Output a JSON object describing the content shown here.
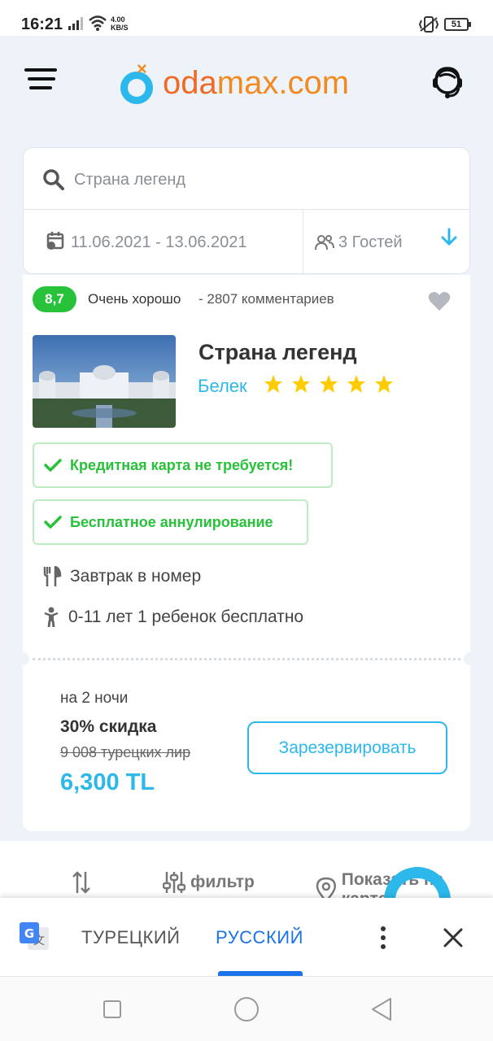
{
  "status_bar": {
    "time": "16:21",
    "speed_value": "4.00",
    "speed_unit": "KB/S",
    "battery": "51"
  },
  "header": {
    "logo_part1": "oda",
    "logo_part2": "max",
    "logo_part3": ".com"
  },
  "search": {
    "query": "Страна легенд",
    "dates": "11.06.2021 - 13.06.2021",
    "guests": "3 Гостей"
  },
  "hotel": {
    "rating": "8,7",
    "rating_word": "Очень хорошо",
    "reviews": "- 2807 комментариев",
    "name": "Страна легенд",
    "city": "Белек",
    "stars": 5,
    "features": [
      {
        "label": "Кредитная карта не требуется!"
      },
      {
        "label": "Бесплатное аннулирование"
      }
    ],
    "amenities": [
      {
        "icon": "fork-knife-icon",
        "label": "Завтрак в номер"
      },
      {
        "icon": "child-icon",
        "label": "0-11 лет 1 ребенок бесплатно"
      }
    ],
    "nights": "на 2 ночи",
    "discount": "30% скидка",
    "old_price": "9 008 турецких  лир",
    "new_price": "6,300  TL",
    "book_label": "Зарезервировать"
  },
  "actions": {
    "filter_label": "фильтр",
    "map_label": "Показать на карте"
  },
  "translate": {
    "source_lang": "ТУРЕЦКИЙ",
    "target_lang": "РУССКИЙ"
  },
  "colors": {
    "accent": "#2cb8ea",
    "green": "#28c23a",
    "logo_orange": "#f06a25",
    "star": "#ffcc00",
    "translate_blue": "#1a73e8"
  }
}
